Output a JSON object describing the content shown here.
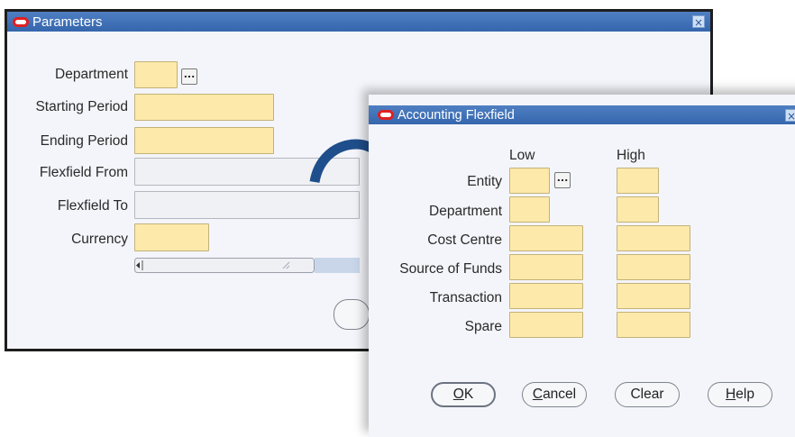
{
  "parameters": {
    "title": "Parameters",
    "close_label": "×",
    "fields": [
      {
        "label": "Department",
        "value": ""
      },
      {
        "label": "Starting Period",
        "value": ""
      },
      {
        "label": "Ending Period",
        "value": ""
      },
      {
        "label": "Flexfield From",
        "value": ""
      },
      {
        "label": "Flexfield To",
        "value": ""
      },
      {
        "label": "Currency",
        "value": ""
      }
    ],
    "lov_label": "..."
  },
  "flexfield": {
    "title": "Accounting Flexfield",
    "close_label": "×",
    "col_low": "Low",
    "col_high": "High",
    "rows": [
      {
        "label": "Entity"
      },
      {
        "label": "Department"
      },
      {
        "label": "Cost Centre"
      },
      {
        "label": "Source of Funds"
      },
      {
        "label": "Transaction"
      },
      {
        "label": "Spare"
      }
    ],
    "lov_label": "...",
    "buttons": {
      "ok": {
        "mnemonic": "O",
        "rest": "K"
      },
      "cancel": {
        "mnemonic": "C",
        "rest": "ancel"
      },
      "clear": {
        "label": "Clear"
      },
      "help": {
        "mnemonic": "H",
        "rest": "elp"
      }
    }
  },
  "colors": {
    "titlebar": "#3f72b8",
    "required_field": "#fde9a9",
    "window_bg": "#f4f5fa",
    "arrow": "#1f4e8c"
  }
}
